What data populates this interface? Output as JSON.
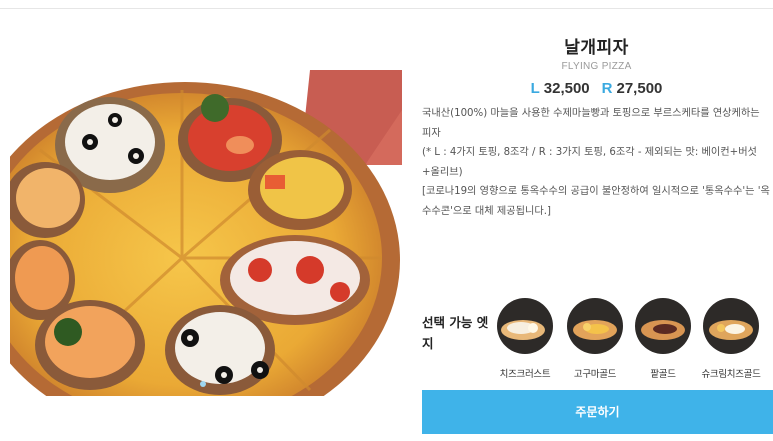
{
  "product": {
    "name": "날개피자",
    "name_en": "FLYING PIZZA",
    "price_l_label": "L",
    "price_l": "32,500",
    "price_r_label": "R",
    "price_r": "27,500",
    "description": [
      "국내산(100%) 마늘을 사용한 수제마늘빵과 토핑으로 부르스케타를 연상케하는 피자",
      "(* L : 4가지 토핑, 8조각 / R : 3가지 토핑, 6조각 - 제외되는 맛: 베이컨+버섯+올리브)",
      "[코로나19의 영향으로 통옥수수의 공급이 불안정하여 일시적으로 '통옥수수'는 '옥수수콘'으로 대체 제공됩니다.]"
    ]
  },
  "edge": {
    "label": "선택 가능 엣지",
    "options": [
      {
        "name": "치즈크러스트",
        "icon": "cheese-crust-icon"
      },
      {
        "name": "고구마골드",
        "icon": "sweet-potato-gold-icon"
      },
      {
        "name": "팥골드",
        "icon": "red-bean-gold-icon"
      },
      {
        "name": "슈크림치즈골드",
        "icon": "cream-cheese-gold-icon"
      }
    ]
  },
  "order_button": "주문하기",
  "colors": {
    "accent": "#3fb3e9",
    "price_label": "#3aa9e0",
    "thumb_bg": "#2d2a28"
  }
}
